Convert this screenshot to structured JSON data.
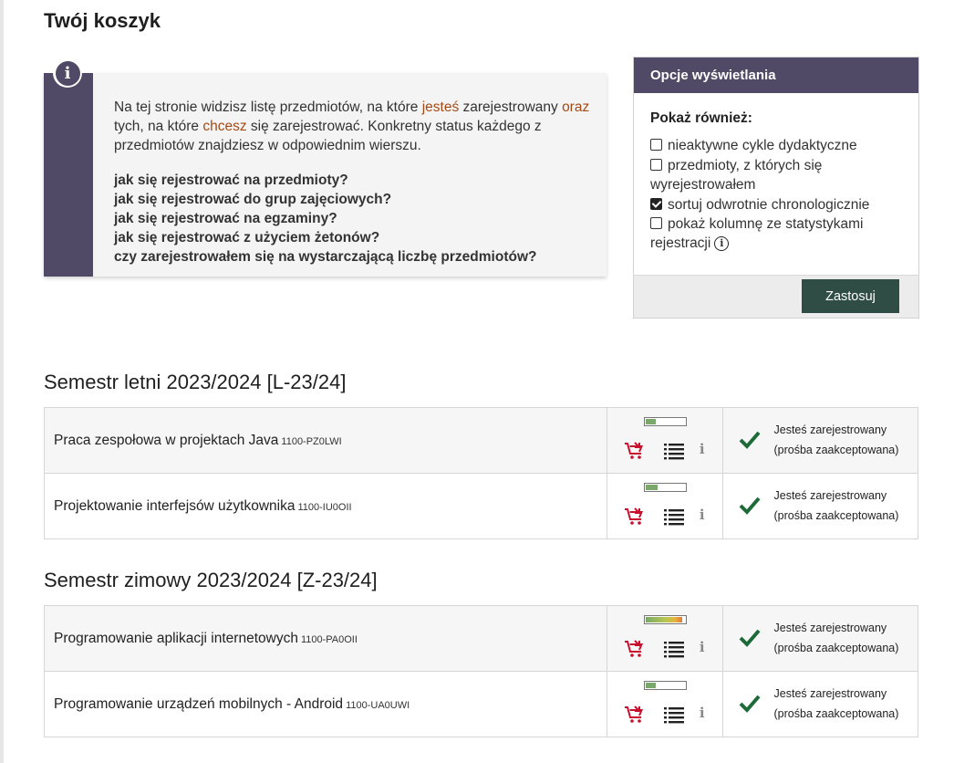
{
  "page_title": "Twój koszyk",
  "info": {
    "text_1": "Na tej stronie widzisz listę przedmiotów, na które ",
    "hl_1": "jesteś",
    "text_2": " zarejestrowany ",
    "hl_2": "oraz",
    "text_3": " tych, na które ",
    "hl_3": "chcesz",
    "text_4": " się zarejestrować. Konkretny status każdego z przedmiotów znajdziesz w odpowiednim wierszu.",
    "links": [
      "jak się rejestrować na przedmioty?",
      "jak się rejestrować do grup zajęciowych?",
      "jak się rejestrować na egzaminy?",
      "jak się rejestrować z użyciem żetonów?",
      "czy zarejestrowałem się na wystarczającą liczbę przedmiotów?"
    ]
  },
  "options": {
    "header": "Opcje wyświetlania",
    "subheader": "Pokaż również:",
    "items": [
      {
        "label": "nieaktywne cykle dydaktyczne",
        "checked": false
      },
      {
        "label": "przedmioty, z których się wyrejestrowałem",
        "checked": false
      },
      {
        "label": "sortuj odwrotnie chronologicznie",
        "checked": true
      },
      {
        "label": "pokaż kolumnę ze statystykami rejestracji",
        "checked": false
      }
    ],
    "apply_label": "Zastosuj"
  },
  "semesters": [
    {
      "title": "Semestr letni 2023/2024 [L-23/24]",
      "courses": [
        {
          "name": "Praca zespołowa w projektach Java",
          "code": "1100-PZ0LWI",
          "fill": 0.25,
          "status_1": "Jesteś zarejestrowany",
          "status_2": "(prośba zaakceptowana)"
        },
        {
          "name": "Projektowanie interfejsów użytkownika",
          "code": "1100-IU0OII",
          "fill": 0.3,
          "status_1": "Jesteś zarejestrowany",
          "status_2": "(prośba zaakceptowana)"
        }
      ]
    },
    {
      "title": "Semestr zimowy 2023/2024 [Z-23/24]",
      "courses": [
        {
          "name": "Programowanie aplikacji internetowych",
          "code": "1100-PA0OII",
          "fill": 0.92,
          "status_1": "Jesteś zarejestrowany",
          "status_2": "(prośba zaakceptowana)"
        },
        {
          "name": "Programowanie urządzeń mobilnych - Android",
          "code": "1100-UA0UWI",
          "fill": 0.25,
          "status_1": "Jesteś zarejestrowany",
          "status_2": "(prośba zaakceptowana)"
        }
      ]
    }
  ],
  "colors": {
    "accent_purple": "#504a66",
    "highlight_text": "#a44a14",
    "button_green": "#2f4c45",
    "check_green": "#1e6b3a",
    "cart_red": "#c8102e"
  },
  "icons": {
    "info": "info-icon",
    "cart": "cart-register-icon",
    "list": "list-icon",
    "details": "info-i-icon",
    "status": "check-icon"
  }
}
